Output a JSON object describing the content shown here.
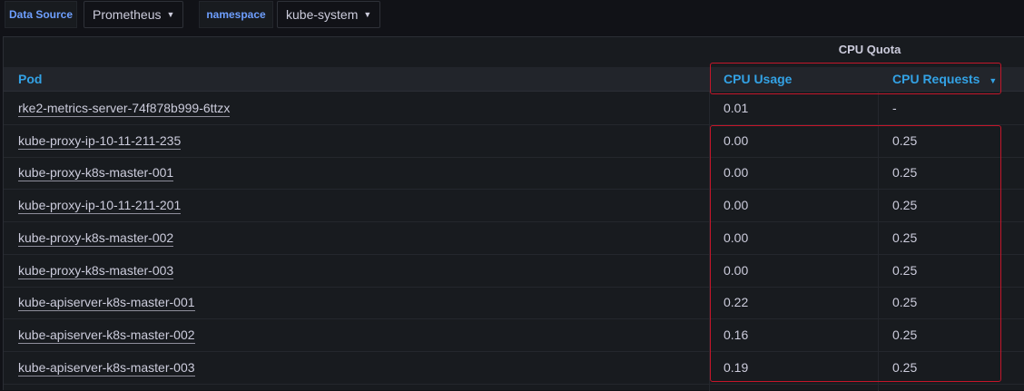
{
  "variables": {
    "datasource_label": "Data Source",
    "datasource_value": "Prometheus",
    "namespace_label": "namespace",
    "namespace_value": "kube-system"
  },
  "table": {
    "group_header": "CPU Quota",
    "columns": {
      "pod": "Pod",
      "usage": "CPU Usage",
      "requests": "CPU Requests"
    },
    "rows": [
      {
        "pod": "rke2-metrics-server-74f878b999-6ttzx",
        "usage": "0.01",
        "requests": "-"
      },
      {
        "pod": "kube-proxy-ip-10-11-211-235",
        "usage": "0.00",
        "requests": "0.25"
      },
      {
        "pod": "kube-proxy-k8s-master-001",
        "usage": "0.00",
        "requests": "0.25"
      },
      {
        "pod": "kube-proxy-ip-10-11-211-201",
        "usage": "0.00",
        "requests": "0.25"
      },
      {
        "pod": "kube-proxy-k8s-master-002",
        "usage": "0.00",
        "requests": "0.25"
      },
      {
        "pod": "kube-proxy-k8s-master-003",
        "usage": "0.00",
        "requests": "0.25"
      },
      {
        "pod": "kube-apiserver-k8s-master-001",
        "usage": "0.22",
        "requests": "0.25"
      },
      {
        "pod": "kube-apiserver-k8s-master-002",
        "usage": "0.16",
        "requests": "0.25"
      },
      {
        "pod": "kube-apiserver-k8s-master-003",
        "usage": "0.19",
        "requests": "0.25"
      }
    ]
  },
  "icons": {
    "dropdown": "chevron-down-icon",
    "sort": "sort-desc-icon"
  },
  "colors": {
    "background": "#111217",
    "panel": "#181b1f",
    "accent": "#33a2e5",
    "variable_label": "#6e9fff",
    "highlight": "#c4162a"
  }
}
